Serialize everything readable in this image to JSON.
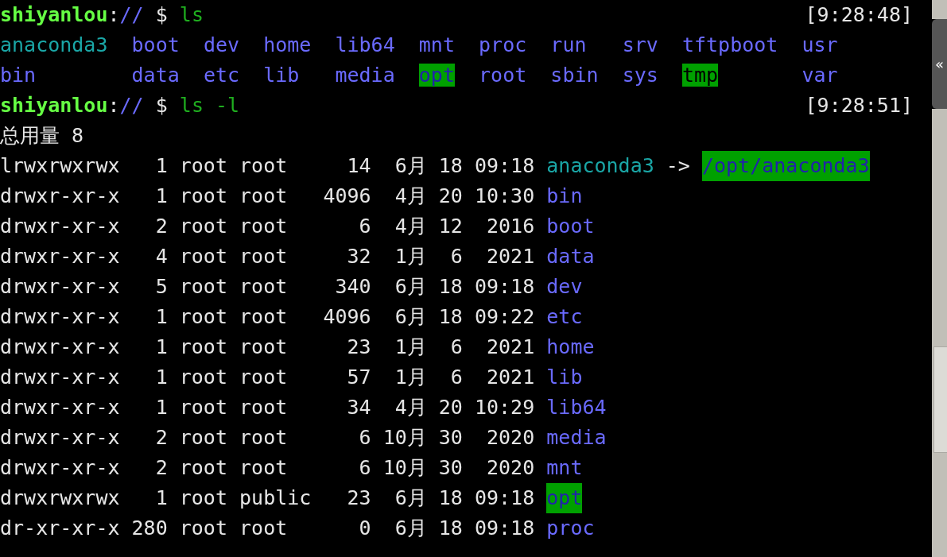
{
  "terminal": {
    "prompt_1": {
      "user": "shiyanlou",
      "separator": ":",
      "path": "//",
      "symbol": "$",
      "command": "ls",
      "time": "[9:28:48]"
    },
    "ls_columns": [
      [
        {
          "name": "anaconda3",
          "kind": "link"
        },
        {
          "name": "bin",
          "kind": "dir"
        }
      ],
      [
        {
          "name": "boot",
          "kind": "dir"
        },
        {
          "name": "data",
          "kind": "dir"
        }
      ],
      [
        {
          "name": "dev",
          "kind": "dir"
        },
        {
          "name": "etc",
          "kind": "dir"
        }
      ],
      [
        {
          "name": "home",
          "kind": "dir"
        },
        {
          "name": "lib",
          "kind": "dir"
        }
      ],
      [
        {
          "name": "lib64",
          "kind": "dir"
        },
        {
          "name": "media",
          "kind": "dir"
        }
      ],
      [
        {
          "name": "mnt",
          "kind": "dir"
        },
        {
          "name": "opt",
          "kind": "writable"
        }
      ],
      [
        {
          "name": "proc",
          "kind": "dir"
        },
        {
          "name": "root",
          "kind": "dir"
        }
      ],
      [
        {
          "name": "run",
          "kind": "dir"
        },
        {
          "name": "sbin",
          "kind": "dir"
        }
      ],
      [
        {
          "name": "srv",
          "kind": "dir"
        },
        {
          "name": "sys",
          "kind": "dir"
        }
      ],
      [
        {
          "name": "tftpboot",
          "kind": "dir"
        },
        {
          "name": "tmp",
          "kind": "sticky"
        }
      ],
      [
        {
          "name": "usr",
          "kind": "dir"
        },
        {
          "name": "var",
          "kind": "dir"
        }
      ]
    ],
    "prompt_2": {
      "user": "shiyanlou",
      "separator": ":",
      "path": "//",
      "symbol": "$",
      "command": "ls -l",
      "time": "[9:28:51]"
    },
    "total": "总用量 8",
    "listing": [
      {
        "perms": "lrwxrwxrwx",
        "links": "1",
        "owner": "root",
        "group": "root",
        "size": "14",
        "month": "6月",
        "day": "18",
        "time": "09:18",
        "name": "anaconda3",
        "kind": "link",
        "arrow": "->",
        "target": {
          "name": "/opt/anaconda3",
          "kind": "writable"
        }
      },
      {
        "perms": "drwxr-xr-x",
        "links": "1",
        "owner": "root",
        "group": "root",
        "size": "4096",
        "month": "4月",
        "day": "20",
        "time": "10:30",
        "name": "bin",
        "kind": "dir"
      },
      {
        "perms": "drwxr-xr-x",
        "links": "2",
        "owner": "root",
        "group": "root",
        "size": "6",
        "month": "4月",
        "day": "12",
        "time": "2016",
        "name": "boot",
        "kind": "dir"
      },
      {
        "perms": "drwxr-xr-x",
        "links": "4",
        "owner": "root",
        "group": "root",
        "size": "32",
        "month": "1月",
        "day": "6",
        "time": "2021",
        "name": "data",
        "kind": "dir"
      },
      {
        "perms": "drwxr-xr-x",
        "links": "5",
        "owner": "root",
        "group": "root",
        "size": "340",
        "month": "6月",
        "day": "18",
        "time": "09:18",
        "name": "dev",
        "kind": "dir"
      },
      {
        "perms": "drwxr-xr-x",
        "links": "1",
        "owner": "root",
        "group": "root",
        "size": "4096",
        "month": "6月",
        "day": "18",
        "time": "09:22",
        "name": "etc",
        "kind": "dir"
      },
      {
        "perms": "drwxr-xr-x",
        "links": "1",
        "owner": "root",
        "group": "root",
        "size": "23",
        "month": "1月",
        "day": "6",
        "time": "2021",
        "name": "home",
        "kind": "dir"
      },
      {
        "perms": "drwxr-xr-x",
        "links": "1",
        "owner": "root",
        "group": "root",
        "size": "57",
        "month": "1月",
        "day": "6",
        "time": "2021",
        "name": "lib",
        "kind": "dir"
      },
      {
        "perms": "drwxr-xr-x",
        "links": "1",
        "owner": "root",
        "group": "root",
        "size": "34",
        "month": "4月",
        "day": "20",
        "time": "10:29",
        "name": "lib64",
        "kind": "dir"
      },
      {
        "perms": "drwxr-xr-x",
        "links": "2",
        "owner": "root",
        "group": "root",
        "size": "6",
        "month": "10月",
        "day": "30",
        "time": "2020",
        "name": "media",
        "kind": "dir"
      },
      {
        "perms": "drwxr-xr-x",
        "links": "2",
        "owner": "root",
        "group": "root",
        "size": "6",
        "month": "10月",
        "day": "30",
        "time": "2020",
        "name": "mnt",
        "kind": "dir"
      },
      {
        "perms": "drwxrwxrwx",
        "links": "1",
        "owner": "root",
        "group": "public",
        "size": "23",
        "month": "6月",
        "day": "18",
        "time": "09:18",
        "name": "opt",
        "kind": "writable"
      },
      {
        "perms": "dr-xr-xr-x",
        "links": "280",
        "owner": "root",
        "group": "root",
        "size": "0",
        "month": "6月",
        "day": "18",
        "time": "09:18",
        "name": "proc",
        "kind": "dir"
      }
    ]
  },
  "side_tab": {
    "label": "«"
  }
}
